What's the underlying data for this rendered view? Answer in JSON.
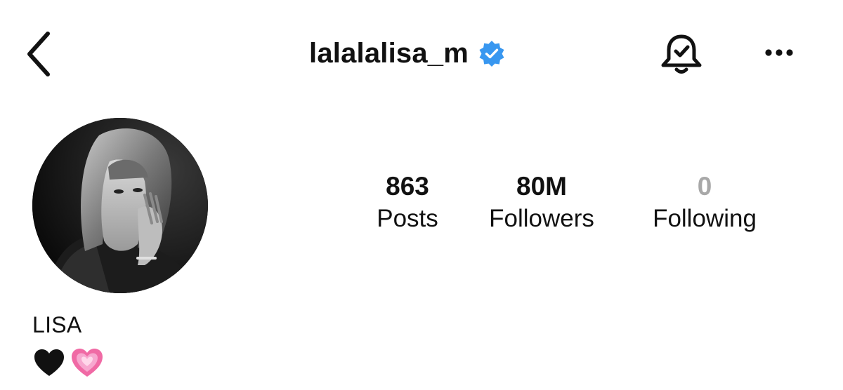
{
  "header": {
    "back_icon": "chevron-left-icon",
    "username": "lalalalisa_m",
    "verified_icon": "verified-badge-icon",
    "verified_color": "#3897f0",
    "notification_icon": "bell-check-icon",
    "more_icon": "more-horizontal-icon"
  },
  "profile": {
    "avatar_icon": "profile-photo",
    "stats": {
      "posts": {
        "value": "863",
        "label": "Posts"
      },
      "followers": {
        "value": "80M",
        "label": "Followers"
      },
      "following": {
        "value": "0",
        "label": "Following"
      }
    },
    "display_name": "LISA",
    "bio_emojis": [
      "black-heart-icon",
      "growing-heart-icon"
    ]
  }
}
